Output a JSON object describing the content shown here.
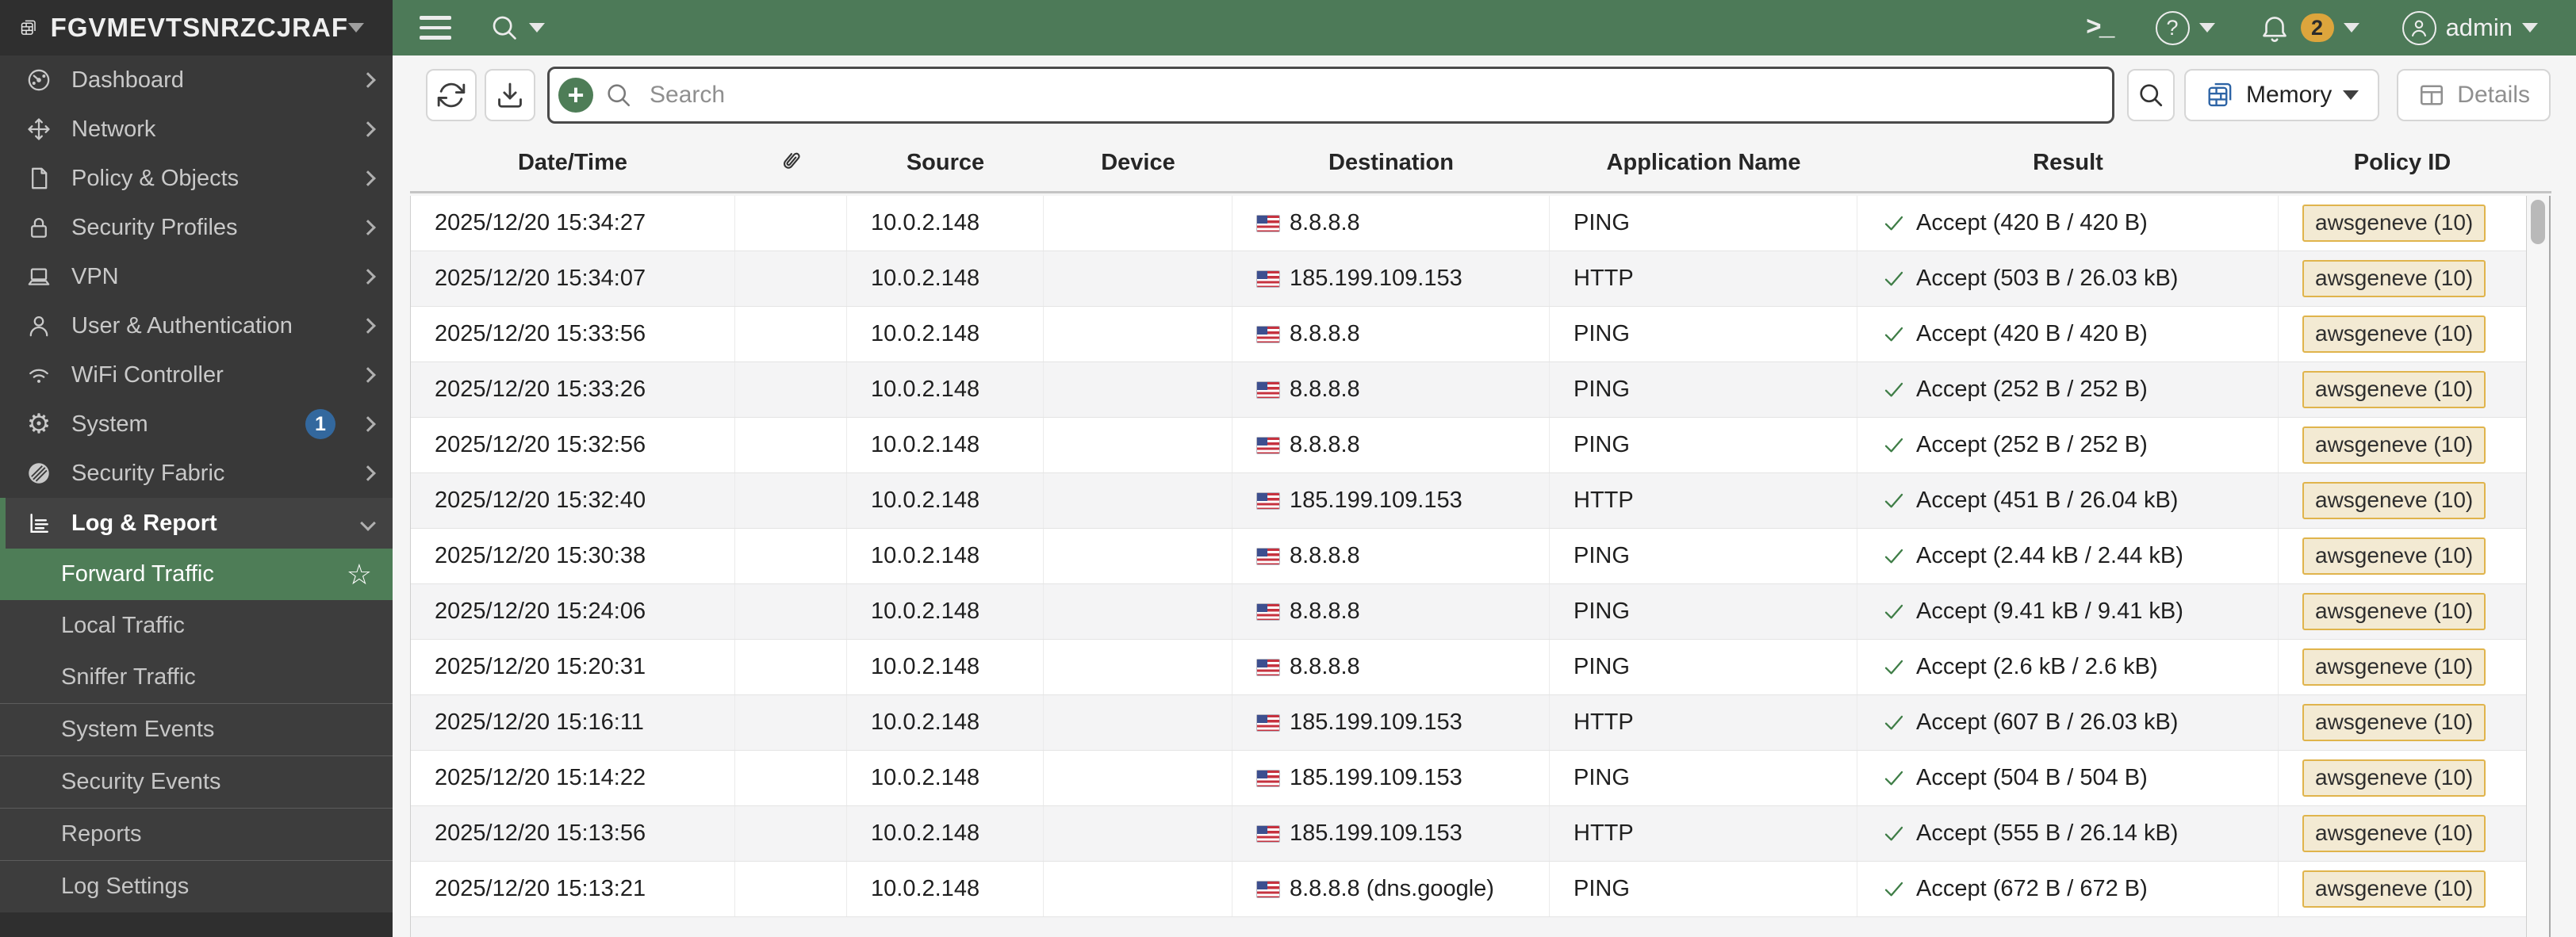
{
  "topbar": {
    "hostname": "FGVMEVTSNRZCJRAF",
    "notification_count": "2",
    "user": "admin"
  },
  "icons": {
    "system_gear": "⚙",
    "favorite_star": "☆",
    "add_filter": "+",
    "cli": ">_",
    "help": "?"
  },
  "sidebar": {
    "items": [
      {
        "label": "Dashboard"
      },
      {
        "label": "Network"
      },
      {
        "label": "Policy & Objects"
      },
      {
        "label": "Security Profiles"
      },
      {
        "label": "VPN"
      },
      {
        "label": "User & Authentication"
      },
      {
        "label": "WiFi Controller"
      },
      {
        "label": "System",
        "badge": "1"
      },
      {
        "label": "Security Fabric"
      },
      {
        "label": "Log & Report",
        "expanded": true
      }
    ],
    "subitems": [
      {
        "label": "Forward Traffic",
        "selected": true
      },
      {
        "label": "Local Traffic"
      },
      {
        "label": "Sniffer Traffic"
      },
      {
        "label": "System Events"
      },
      {
        "label": "Security Events"
      },
      {
        "label": "Reports"
      },
      {
        "label": "Log Settings"
      }
    ]
  },
  "toolbar": {
    "search_placeholder": "Search",
    "log_source_label": "Memory",
    "details_label": "Details"
  },
  "table": {
    "columns": [
      "Date/Time",
      "",
      "Source",
      "Device",
      "Destination",
      "Application Name",
      "Result",
      "Policy ID"
    ],
    "rows": [
      {
        "date_time": "2025/12/20 15:34:27",
        "source": "10.0.2.148",
        "device": "",
        "destination": "8.8.8.8",
        "dest_country": "US",
        "application": "PING",
        "result": "Accept (420 B / 420 B)",
        "policy_id": "awsgeneve (10)"
      },
      {
        "date_time": "2025/12/20 15:34:07",
        "source": "10.0.2.148",
        "device": "",
        "destination": "185.199.109.153",
        "dest_country": "US",
        "application": "HTTP",
        "result": "Accept (503 B / 26.03 kB)",
        "policy_id": "awsgeneve (10)"
      },
      {
        "date_time": "2025/12/20 15:33:56",
        "source": "10.0.2.148",
        "device": "",
        "destination": "8.8.8.8",
        "dest_country": "US",
        "application": "PING",
        "result": "Accept (420 B / 420 B)",
        "policy_id": "awsgeneve (10)"
      },
      {
        "date_time": "2025/12/20 15:33:26",
        "source": "10.0.2.148",
        "device": "",
        "destination": "8.8.8.8",
        "dest_country": "US",
        "application": "PING",
        "result": "Accept (252 B / 252 B)",
        "policy_id": "awsgeneve (10)"
      },
      {
        "date_time": "2025/12/20 15:32:56",
        "source": "10.0.2.148",
        "device": "",
        "destination": "8.8.8.8",
        "dest_country": "US",
        "application": "PING",
        "result": "Accept (252 B / 252 B)",
        "policy_id": "awsgeneve (10)"
      },
      {
        "date_time": "2025/12/20 15:32:40",
        "source": "10.0.2.148",
        "device": "",
        "destination": "185.199.109.153",
        "dest_country": "US",
        "application": "HTTP",
        "result": "Accept (451 B / 26.04 kB)",
        "policy_id": "awsgeneve (10)"
      },
      {
        "date_time": "2025/12/20 15:30:38",
        "source": "10.0.2.148",
        "device": "",
        "destination": "8.8.8.8",
        "dest_country": "US",
        "application": "PING",
        "result": "Accept (2.44 kB / 2.44 kB)",
        "policy_id": "awsgeneve (10)"
      },
      {
        "date_time": "2025/12/20 15:24:06",
        "source": "10.0.2.148",
        "device": "",
        "destination": "8.8.8.8",
        "dest_country": "US",
        "application": "PING",
        "result": "Accept (9.41 kB / 9.41 kB)",
        "policy_id": "awsgeneve (10)"
      },
      {
        "date_time": "2025/12/20 15:20:31",
        "source": "10.0.2.148",
        "device": "",
        "destination": "8.8.8.8",
        "dest_country": "US",
        "application": "PING",
        "result": "Accept (2.6 kB / 2.6 kB)",
        "policy_id": "awsgeneve (10)"
      },
      {
        "date_time": "2025/12/20 15:16:11",
        "source": "10.0.2.148",
        "device": "",
        "destination": "185.199.109.153",
        "dest_country": "US",
        "application": "HTTP",
        "result": "Accept (607 B / 26.03 kB)",
        "policy_id": "awsgeneve (10)"
      },
      {
        "date_time": "2025/12/20 15:14:22",
        "source": "10.0.2.148",
        "device": "",
        "destination": "185.199.109.153",
        "dest_country": "US",
        "application": "PING",
        "result": "Accept (504 B / 504 B)",
        "policy_id": "awsgeneve (10)"
      },
      {
        "date_time": "2025/12/20 15:13:56",
        "source": "10.0.2.148",
        "device": "",
        "destination": "185.199.109.153",
        "dest_country": "US",
        "application": "HTTP",
        "result": "Accept (555 B / 26.14 kB)",
        "policy_id": "awsgeneve (10)"
      },
      {
        "date_time": "2025/12/20 15:13:21",
        "source": "10.0.2.148",
        "device": "",
        "destination": "8.8.8.8 (dns.google)",
        "dest_country": "US",
        "application": "PING",
        "result": "Accept (672 B / 672 B)",
        "policy_id": "awsgeneve (10)"
      }
    ]
  },
  "colors": {
    "accent_green": "#4d7a58",
    "selected_item_green": "#4e7d57",
    "sidebar_bg": "#393939",
    "topbar_logo_bg": "#2f2f2f",
    "policy_badge_bg": "#f3ead3",
    "policy_badge_border": "#e0b44c",
    "notification_badge": "#dda53c",
    "system_count_badge": "#33689e",
    "accept_check_green": "#3e7d46",
    "memory_icon_blue": "#2c63a5"
  }
}
